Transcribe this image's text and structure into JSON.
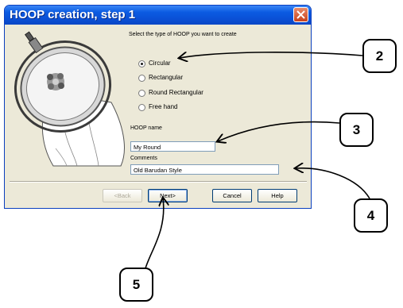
{
  "dialog": {
    "title": "HOOP creation, step 1",
    "prompt": "Select the type of HOOP you want to create",
    "hoop_types": [
      {
        "label": "Circular",
        "selected": true
      },
      {
        "label": "Rectangular",
        "selected": false
      },
      {
        "label": "Round Rectangular",
        "selected": false
      },
      {
        "label": "Free hand",
        "selected": false
      }
    ],
    "name_label": "HOOP name",
    "name_value": "My Round",
    "comments_label": "Comments",
    "comments_value": "Old Barudan Style",
    "buttons": {
      "back": "<Back",
      "next": "Next>",
      "cancel": "Cancel",
      "help": "Help"
    }
  },
  "callouts": [
    "2",
    "3",
    "4",
    "5"
  ],
  "colors": {
    "titlebar": "#0b5be2",
    "dialog_bg": "#ece9d8",
    "close_button": "#c8421c"
  }
}
